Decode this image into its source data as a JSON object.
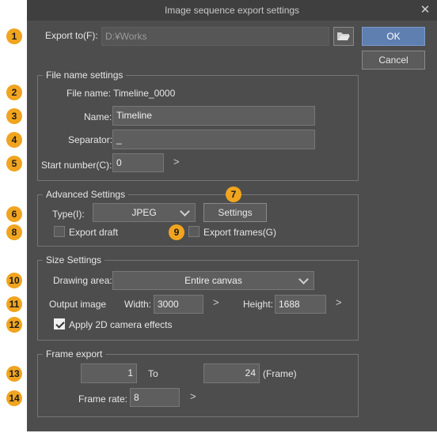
{
  "window": {
    "title": "Image sequence export settings",
    "close_glyph": "✕"
  },
  "export_to": {
    "label": "Export to(F):",
    "path": "D:¥Works"
  },
  "buttons": {
    "ok": "OK",
    "cancel": "Cancel",
    "settings": "Settings"
  },
  "file_name_settings": {
    "title": "File name settings",
    "file_name_label": "File name:",
    "file_name_value": "Timeline_0000",
    "name_label": "Name:",
    "name_value": "Timeline",
    "separator_label": "Separator:",
    "separator_value": "_",
    "start_number_label": "Start number(C):",
    "start_number_value": "0"
  },
  "advanced_settings": {
    "title": "Advanced Settings",
    "type_label": "Type(I):",
    "type_value": "JPEG",
    "export_draft_label": "Export draft",
    "export_draft_checked": false,
    "export_frames_label": "Export frames(G)",
    "export_frames_checked": false
  },
  "size_settings": {
    "title": "Size Settings",
    "drawing_area_label": "Drawing area:",
    "drawing_area_value": "Entire canvas",
    "output_image_label": "Output image",
    "width_label": "Width:",
    "width_value": "3000",
    "height_label": "Height:",
    "height_value": "1688",
    "camera_effects_label": "Apply 2D camera effects",
    "camera_effects_checked": true
  },
  "frame_export": {
    "title": "Frame export",
    "from_value": "1",
    "to_label": "To",
    "to_value": "24",
    "frame_unit": "(Frame)",
    "frame_rate_label": "Frame rate:",
    "frame_rate_value": "8"
  },
  "callouts": [
    "1",
    "2",
    "3",
    "4",
    "5",
    "6",
    "7",
    "8",
    "9",
    "10",
    "11",
    "12",
    "13",
    "14"
  ],
  "colors": {
    "callout": "#f0a41f",
    "ok_button": "#5f7fb0",
    "dialog_bg": "#4d4d4d"
  },
  "icons": {
    "folder": "folder-open-icon",
    "chevron": "chevron-right-icon",
    "dropdown": "chevron-down-icon",
    "close": "close-icon"
  }
}
